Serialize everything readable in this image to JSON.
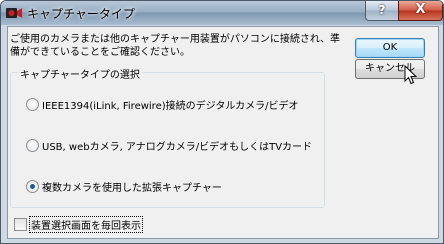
{
  "window": {
    "title": "キャプチャータイプ",
    "help_label": "?",
    "close_label": "X"
  },
  "description": "ご使用のカメラまたは他のキャプチャー用装置がパソコンに接続され、準\n備ができていることをご確認ください。",
  "group": {
    "label": "キャプチャータイプの選択",
    "options": [
      {
        "label": "IEEE1394(iLink, Firewire)接続のデジタルカメラ/ビデオ",
        "checked": false
      },
      {
        "label": "USB, webカメラ, アナログカメラ/ビデオもしくはTVカード",
        "checked": false
      },
      {
        "label": "複数カメラを使用した拡張キャプチャー",
        "checked": true
      }
    ]
  },
  "buttons": {
    "ok": "OK",
    "cancel": "キャンセル"
  },
  "checkbox": {
    "label": "装置選択画面を毎回表示",
    "checked": false
  }
}
